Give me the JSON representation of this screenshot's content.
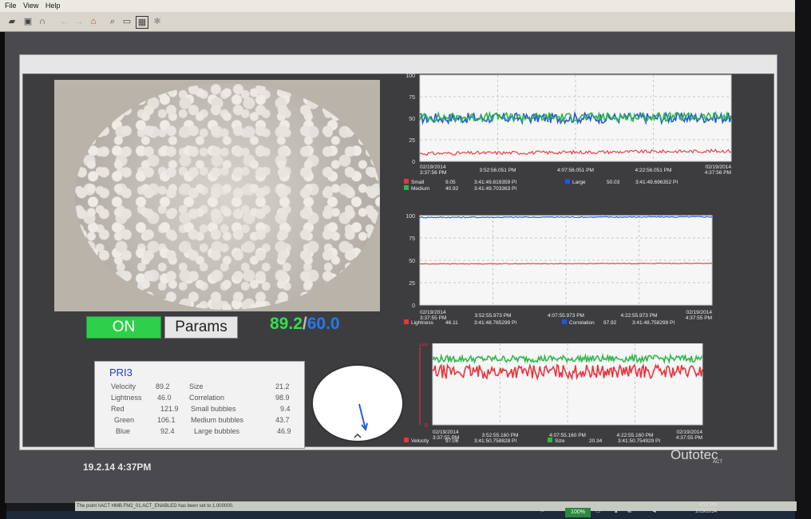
{
  "menubar": {
    "items": [
      "File",
      "View",
      "Help"
    ]
  },
  "toolbar": {
    "icons": [
      "folder-icon",
      "save-icon",
      "magnet-icon",
      "arrow-left-icon",
      "arrow-right-icon",
      "home-icon",
      "zoom-icon",
      "zoom-region-icon",
      "chart-icon",
      "gear-icon"
    ]
  },
  "controls": {
    "on_label": "ON",
    "params_label": "Params",
    "value_a": "89.2",
    "separator": "/",
    "value_b": "60.0"
  },
  "pri": {
    "title": "PRI3",
    "left": [
      {
        "label": "Velocity",
        "value": "89.2"
      },
      {
        "label": "Lightness",
        "value": "46.0"
      },
      {
        "label": "Red",
        "value": "121.9"
      },
      {
        "label": "Green",
        "value": "106.1"
      },
      {
        "label": "Blue",
        "value": "92.4"
      }
    ],
    "right": [
      {
        "label": "Size",
        "value": "21.2"
      },
      {
        "label": "Correlation",
        "value": "98.9"
      },
      {
        "label": "Small bubbles",
        "value": "9.4"
      },
      {
        "label": "Medium bubbles",
        "value": "43.7"
      },
      {
        "label": "Large bubbles",
        "value": "46.9"
      }
    ]
  },
  "status": {
    "datetime": "19.2.14 4:37PM"
  },
  "brand": {
    "logo": "Outotec",
    "sub": "ACT"
  },
  "message_bar": "The point \\\\ACT HMB.FM2_01.ACT_ENABLED has been set to 1.000000.",
  "tray": {
    "zoom": "100%",
    "time": "4:37 PM",
    "date": "2/19/2014"
  },
  "colors": {
    "small": "#e8343c",
    "medium": "#2fb84a",
    "large": "#2255e0",
    "on": "#2ecf4a",
    "readout_a": "#32e04a",
    "readout_b": "#1e7cf0"
  },
  "chart_data": [
    {
      "type": "line",
      "ylim": [
        0,
        100
      ],
      "y_ticks": [
        "100",
        "75",
        "50",
        "25",
        "0"
      ],
      "x_ticks": [
        {
          "date": "02/19/2014",
          "time": "3:37:56 PM"
        },
        {
          "time": "3:52:56.051 PM"
        },
        {
          "time": "4:07:56.051 PM"
        },
        {
          "time": "4:22:56.051 PM"
        },
        {
          "date": "02/19/2014",
          "time": "4:37:56 PM"
        }
      ],
      "series": [
        {
          "name": "Large",
          "level": 50,
          "noise": 6,
          "color": "#2255e0"
        },
        {
          "name": "Medium",
          "level": 51,
          "noise": 5,
          "color": "#2fb84a"
        },
        {
          "name": "Small",
          "level": 9,
          "noise": 2,
          "color": "#e8343c"
        }
      ],
      "legend": [
        {
          "name": "Small",
          "value": "9.05",
          "stamp": "3:41:49.819359 PI",
          "color": "#e8343c"
        },
        {
          "name": "Medium",
          "value": "40.92",
          "stamp": "3:41:49.703363 PI",
          "color": "#2fb84a"
        },
        {
          "name": "Large",
          "value": "50.03",
          "stamp": "3:41:49.696352 PI",
          "color": "#2255e0"
        }
      ]
    },
    {
      "type": "line",
      "ylim": [
        0,
        100
      ],
      "y_ticks": [
        "100",
        "75",
        "50",
        "25",
        "0"
      ],
      "x_ticks": [
        {
          "date": "02/19/2014",
          "time": "3:37:55 PM"
        },
        {
          "time": "3:52:55.973 PM"
        },
        {
          "time": "4:07:55.973 PM"
        },
        {
          "time": "4:22:55.973 PM"
        },
        {
          "date": "02/19/2014",
          "time": "4:37:55 PM"
        }
      ],
      "series": [
        {
          "name": "Correlation",
          "level": 98,
          "noise": 0.7,
          "color": "#2255e0"
        },
        {
          "name": "Lightness",
          "level": 46,
          "noise": 0.4,
          "color": "#e8343c"
        }
      ],
      "legend": [
        {
          "name": "Lightness",
          "value": "46.11",
          "stamp": "3:41:48.765299 PI",
          "color": "#e8343c"
        },
        {
          "name": "Correlation",
          "value": "97.92",
          "stamp": "3:41:48.758299 PI",
          "color": "#2255e0"
        }
      ]
    },
    {
      "type": "line",
      "ylim": [
        0,
        120
      ],
      "y_ticks": [
        "120",
        "0"
      ],
      "x_ticks": [
        {
          "date": "02/19/2014",
          "time": "3:37:55 PM"
        },
        {
          "time": "3:52:55.160 PM"
        },
        {
          "time": "4:07:55.160 PM"
        },
        {
          "time": "4:22:55.160 PM"
        },
        {
          "date": "02/19/2014",
          "time": "4:37:55 PM"
        }
      ],
      "series": [
        {
          "name": "Size",
          "level": 97,
          "noise": 5,
          "color": "#2fb84a"
        },
        {
          "name": "Velocity",
          "level": 78,
          "noise": 10,
          "color": "#e8343c"
        }
      ],
      "legend": [
        {
          "name": "Velocity",
          "value": "97.06",
          "stamp": "3:41:50.758828 PI",
          "color": "#e8343c"
        },
        {
          "name": "Size",
          "value": "20.34",
          "stamp": "3:41:50.754929 PI",
          "color": "#2fb84a"
        }
      ]
    }
  ]
}
